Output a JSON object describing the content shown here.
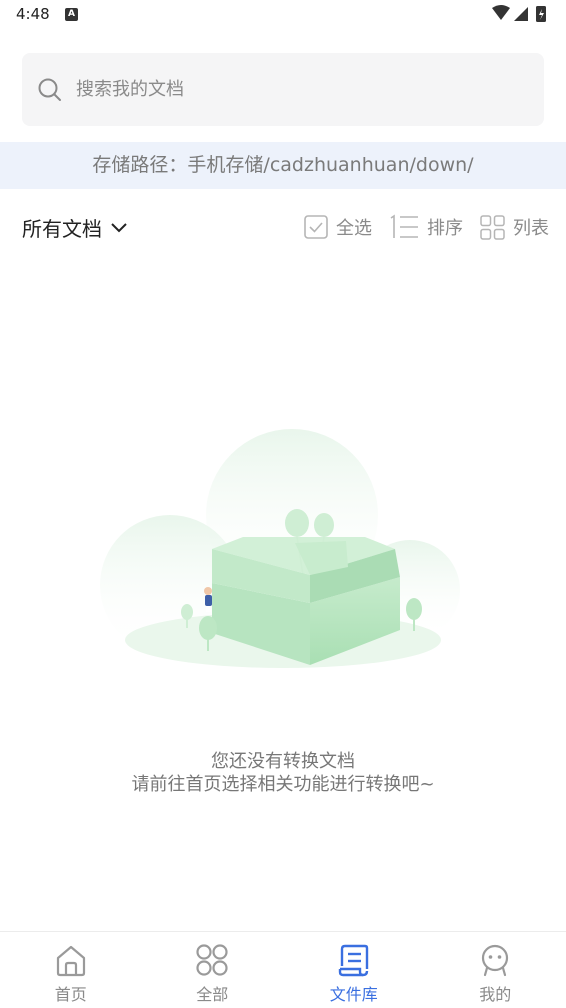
{
  "status_bar": {
    "time": "4:48",
    "notification_badge": "A"
  },
  "search": {
    "placeholder": "搜索我的文档",
    "value": ""
  },
  "storage_path": {
    "text": "存储路径：手机存储/cadzhuanhuan/down/"
  },
  "filter": {
    "dropdown_label": "所有文档",
    "select_all_label": "全选",
    "sort_label": "排序",
    "view_label": "列表"
  },
  "empty_state": {
    "title": "您还没有转换文档",
    "subtitle": "请前往首页选择相关功能进行转换吧~"
  },
  "tabs": [
    {
      "label": "首页",
      "icon": "home-icon",
      "active": false
    },
    {
      "label": "全部",
      "icon": "grid-icon",
      "active": false
    },
    {
      "label": "文件库",
      "icon": "document-icon",
      "active": true
    },
    {
      "label": "我的",
      "icon": "profile-icon",
      "active": false
    }
  ],
  "colors": {
    "accent": "#3a6fe0",
    "banner_bg": "#edf2fb",
    "illustration_green": "#bfe8c6"
  }
}
